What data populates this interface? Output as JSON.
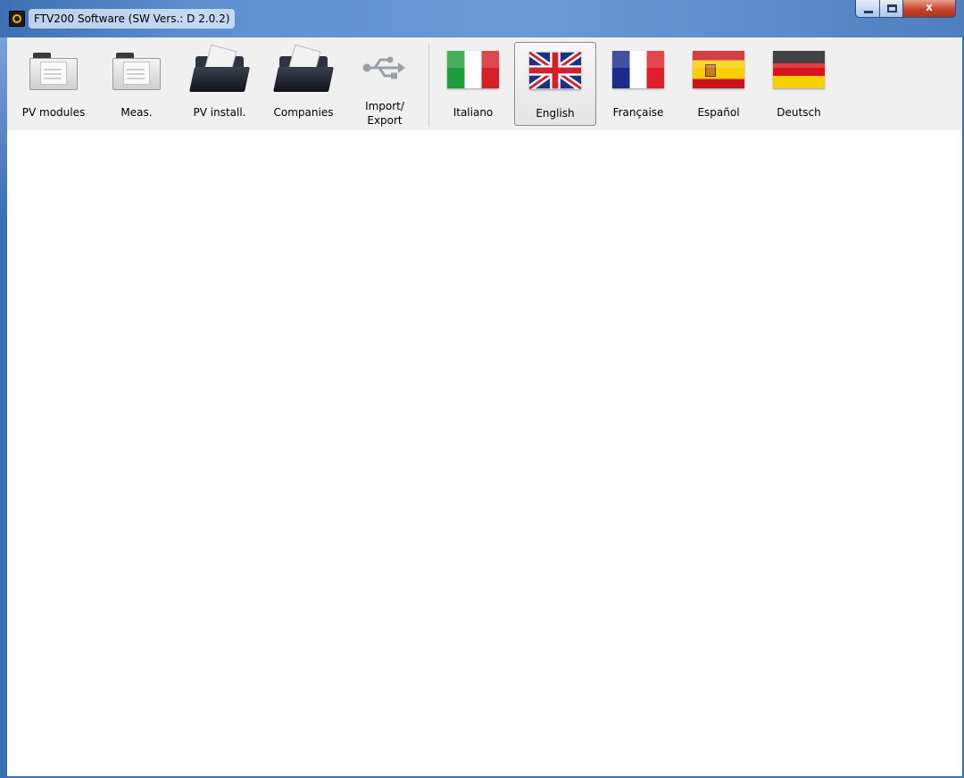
{
  "window": {
    "title": "FTV200 Software (SW Vers.: D 2.0.2)",
    "controls": {
      "minimize": "minimize",
      "maximize": "maximize",
      "close": "x"
    }
  },
  "toolbar": {
    "items": [
      {
        "label": "PV modules",
        "icon": "document-folder-icon"
      },
      {
        "label": "Meas.",
        "icon": "document-folder-icon"
      },
      {
        "label": "PV install.",
        "icon": "open-folder-icon"
      },
      {
        "label": "Companies",
        "icon": "open-folder-icon"
      },
      {
        "label_line1": "Import/",
        "label_line2": "Export",
        "icon": "usb-icon"
      }
    ],
    "languages": [
      {
        "label": "Italiano",
        "icon": "italy-flag-icon"
      },
      {
        "label": "English",
        "icon": "uk-flag-icon",
        "selected": true
      },
      {
        "label": "Française",
        "icon": "france-flag-icon"
      },
      {
        "label": "Español",
        "icon": "spain-flag-icon"
      },
      {
        "label": "Deutsch",
        "icon": "germany-flag-icon"
      }
    ]
  },
  "colors": {
    "titlebar": "#5d8fcf",
    "toolbar": "#f0f0f0",
    "close_button": "#c6442a"
  }
}
